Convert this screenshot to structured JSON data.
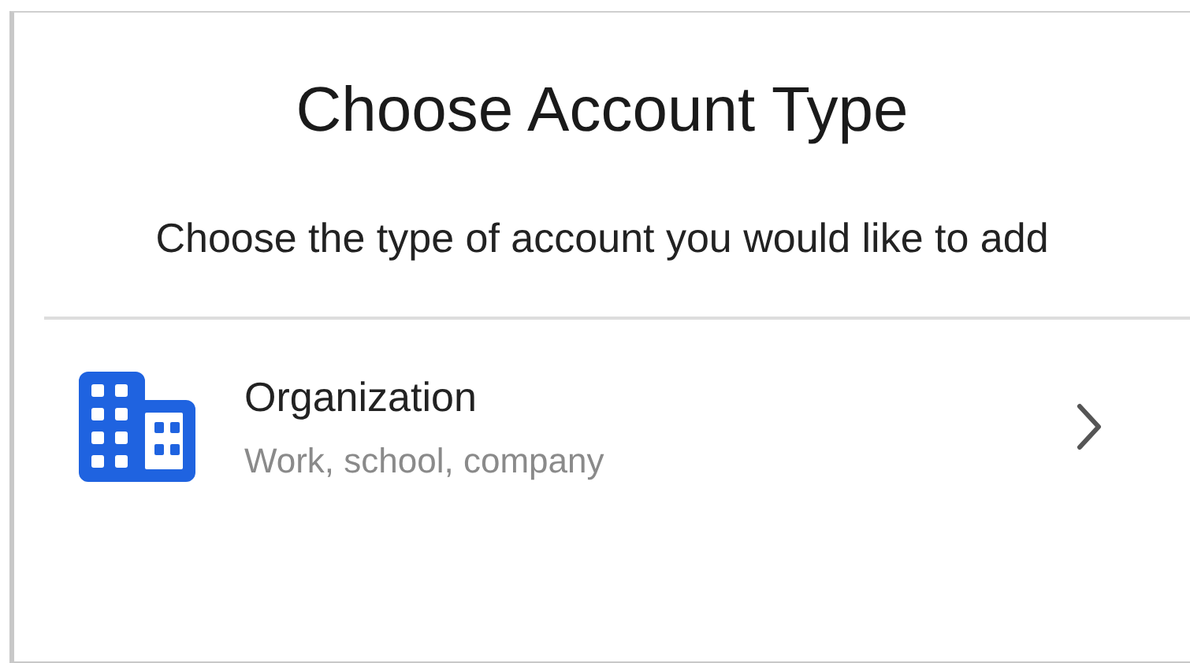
{
  "title": "Choose Account Type",
  "subtitle": "Choose the type of account you would like to add",
  "options": [
    {
      "kind": "organization",
      "label": "Organization",
      "description": "Work, school, company"
    }
  ]
}
